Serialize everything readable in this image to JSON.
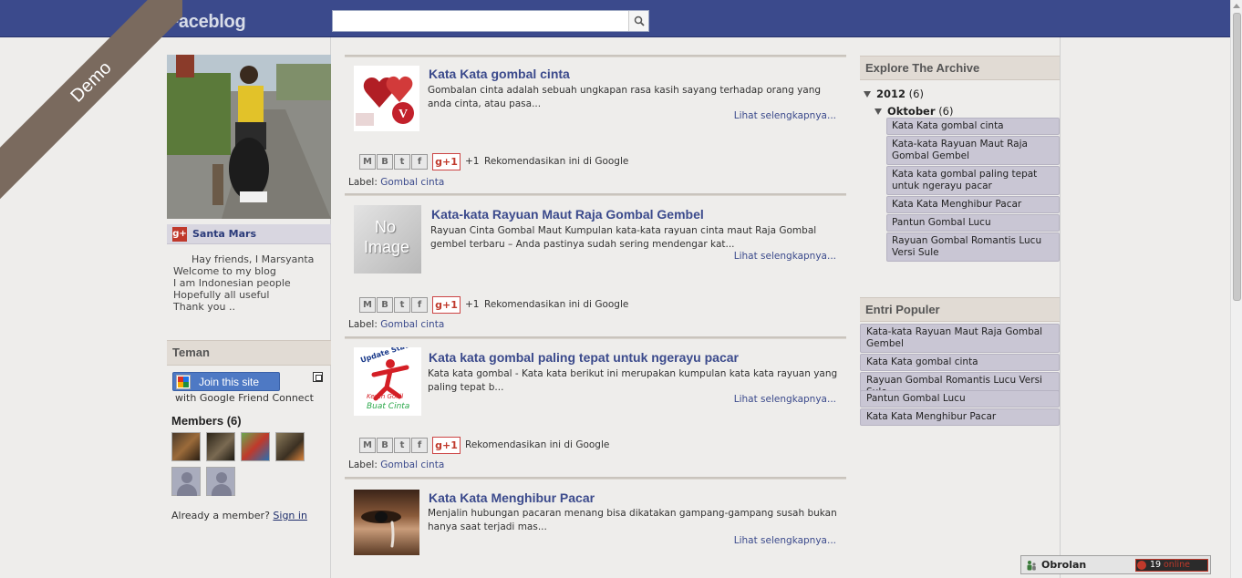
{
  "header": {
    "brand": "Faceblog",
    "search_placeholder": ""
  },
  "ribbon": {
    "label": "Demo"
  },
  "profile": {
    "gplus_badge": "g+",
    "name": "Santa Mars",
    "bio": [
      "Hay friends, I Marsyanta",
      "Welcome to my blog",
      "I am Indonesian people",
      "Hopefully all useful",
      "Thank you .."
    ]
  },
  "friends": {
    "title": "Teman",
    "join_label": "Join this site",
    "join_sub": "with Google Friend Connect",
    "members_title": "Members (6)",
    "signin_prefix": "Already a member?",
    "signin_link": "Sign in"
  },
  "posts": [
    {
      "title": "Kata Kata gombal cinta",
      "snippet": "Gombalan cinta adalah sebuah ungkapan rasa kasih sayang terhadap orang yang anda cinta, atau pasa...",
      "read_more": "Lihat selengkapnya...",
      "plus_one": "+1",
      "recommend": "Rekomendasikan ini di Google",
      "label_prefix": "Label:",
      "label": "Gombal cinta"
    },
    {
      "title": "Kata-kata Rayuan Maut Raja Gombal Gembel",
      "snippet": "Rayuan Cinta Gombal Maut Kumpulan kata-kata rayuan cinta maut Raja Gombal gembel terbaru – Anda pastinya sudah sering mendengar kat...",
      "read_more": "Lihat selengkapnya...",
      "plus_one": "+1",
      "recommend": "Rekomendasikan ini di Google",
      "label_prefix": "Label:",
      "label": "Gombal cinta",
      "thumb_text": [
        "No",
        "Image"
      ]
    },
    {
      "title": "Kata kata gombal paling tepat untuk ngerayu pacar",
      "snippet": "Kata kata gombal - Kata kata berikut ini merupakan kumpulan kata kata rayuan yang paling tepat b...",
      "read_more": "Lihat selengkapnya...",
      "recommend": "Rekomendasikan ini di Google",
      "label_prefix": "Label:",
      "label": "Gombal cinta",
      "thumb_text": [
        "Update Status",
        "Keren Gokil",
        "Buat Cinta"
      ]
    },
    {
      "title": "Kata Kata Menghibur Pacar",
      "snippet": "Menjalin hubungan pacaran menang bisa dikatakan gampang-gampang susah bukan hanya saat terjadi mas...",
      "read_more": "Lihat selengkapnya..."
    }
  ],
  "share": {
    "gplus": "g+1",
    "icons": [
      "email-icon",
      "blogger-icon",
      "twitter-icon",
      "facebook-icon"
    ]
  },
  "archive": {
    "title": "Explore The Archive",
    "year": "2012",
    "year_count": "(6)",
    "month": "Oktober",
    "month_count": "(6)",
    "items": [
      "Kata Kata gombal cinta",
      "Kata-kata Rayuan Maut Raja Gombal Gembel",
      "Kata kata gombal paling tepat untuk ngerayu pacar",
      "Kata Kata Menghibur Pacar",
      "Pantun Gombal Lucu",
      "Rayuan Gombal Romantis Lucu Versi Sule"
    ]
  },
  "popular": {
    "title": "Entri Populer",
    "items": [
      "Kata-kata Rayuan Maut Raja Gombal Gembel",
      "Kata Kata gombal cinta",
      "Rayuan Gombal Romantis Lucu Versi Sule",
      "Pantun Gombal Lucu",
      "Kata Kata Menghibur Pacar"
    ]
  },
  "chat": {
    "label": "Obrolan",
    "online_count": "19",
    "online_word": "online"
  },
  "colors": {
    "topbar": "#3b4a8c",
    "link": "#3b4a8c",
    "ribbon": "#7a6a5e",
    "widget_item": "#c9c6d4"
  }
}
